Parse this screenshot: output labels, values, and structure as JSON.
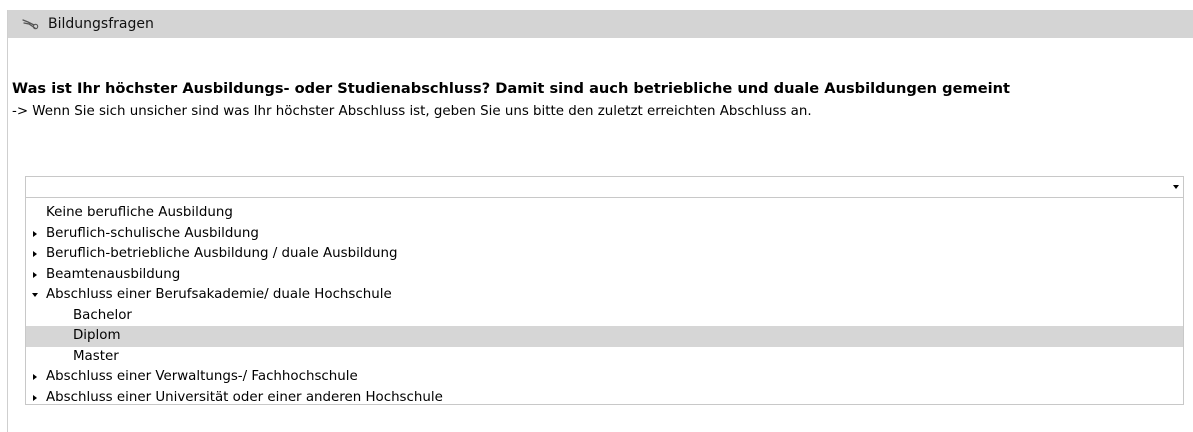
{
  "panel": {
    "title": "Bildungsfragen",
    "icon": "wrench-screwdriver-icon"
  },
  "question": {
    "text": "Was ist Ihr höchster Ausbildungs- oder Studienabschluss? Damit sind auch betriebliche und duale Ausbildungen gemeint",
    "hint": "-> Wenn Sie sich unsicher sind was Ihr höchster Abschluss ist, geben Sie uns bitte den zuletzt erreichten Abschluss an."
  },
  "select": {
    "value": "",
    "open": true
  },
  "options": [
    {
      "label": "Keine berufliche Ausbildung",
      "level": 0,
      "expander": "none",
      "selected": false
    },
    {
      "label": "Beruflich-schulische Ausbildung",
      "level": 0,
      "expander": "collapsed",
      "selected": false
    },
    {
      "label": "Beruflich-betriebliche Ausbildung / duale Ausbildung",
      "level": 0,
      "expander": "collapsed",
      "selected": false
    },
    {
      "label": "Beamtenausbildung",
      "level": 0,
      "expander": "collapsed",
      "selected": false
    },
    {
      "label": "Abschluss einer Berufsakademie/ duale Hochschule",
      "level": 0,
      "expander": "expanded",
      "selected": false
    },
    {
      "label": "Bachelor",
      "level": 1,
      "expander": "none",
      "selected": false
    },
    {
      "label": "Diplom",
      "level": 1,
      "expander": "none",
      "selected": true
    },
    {
      "label": "Master",
      "level": 1,
      "expander": "none",
      "selected": false
    },
    {
      "label": "Abschluss einer Verwaltungs-/ Fachhochschule",
      "level": 0,
      "expander": "collapsed",
      "selected": false
    },
    {
      "label": "Abschluss einer Universität oder einer anderen Hochschule",
      "level": 0,
      "expander": "collapsed",
      "selected": false
    }
  ],
  "colors": {
    "header_bg": "#d4d4d4",
    "selected_bg": "#d6d6d6",
    "border": "#c8c8c8"
  }
}
